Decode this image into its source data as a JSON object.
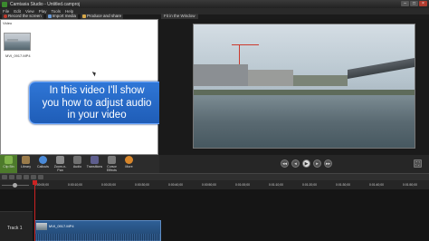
{
  "window": {
    "title": "Camtasia Studio - Untitled.camproj"
  },
  "menu": [
    "File",
    "Edit",
    "View",
    "Play",
    "Tools",
    "Help"
  ],
  "toolbar": {
    "record": "Record the screen",
    "import": "Import media",
    "produce": "Produce and share"
  },
  "clipbin": {
    "label": "Video",
    "clip_name": "MVI_0917.MP4"
  },
  "callout": {
    "line1": "In this video I'll show",
    "line2": "you how to adjust audio",
    "line3": "in your video"
  },
  "preview": {
    "zoom": "Fit in the Window"
  },
  "tasks": [
    {
      "label": "Clip Bin",
      "icon": "film-icon",
      "active": true
    },
    {
      "label": "Library",
      "icon": "library-icon"
    },
    {
      "label": "Callouts",
      "icon": "callout-icon"
    },
    {
      "label": "Zoom-n-Pan",
      "icon": "zoom-icon"
    },
    {
      "label": "Audio",
      "icon": "audio-icon"
    },
    {
      "label": "Transitions",
      "icon": "transitions-icon"
    },
    {
      "label": "Cursor Effects",
      "icon": "cursor-icon"
    },
    {
      "label": "More",
      "icon": "more-icon"
    }
  ],
  "ruler": [
    "0:00:00;00",
    "0:00:10;00",
    "0:00:20;00",
    "0:00:30;00",
    "0:00:40;00",
    "0:00:50;00",
    "0:01:00;00",
    "0:01:10;00",
    "0:01:20;00",
    "0:01:30;00",
    "0:01:40;00",
    "0:01:50;00"
  ],
  "timeline": {
    "track_label": "Track 1",
    "clip_label": "MVI_0917.MP4"
  },
  "colors": {
    "accent": "#4d7a2b",
    "callout": "#2f76d6",
    "clip": "#2e5f96",
    "playhead": "#cc2222"
  }
}
